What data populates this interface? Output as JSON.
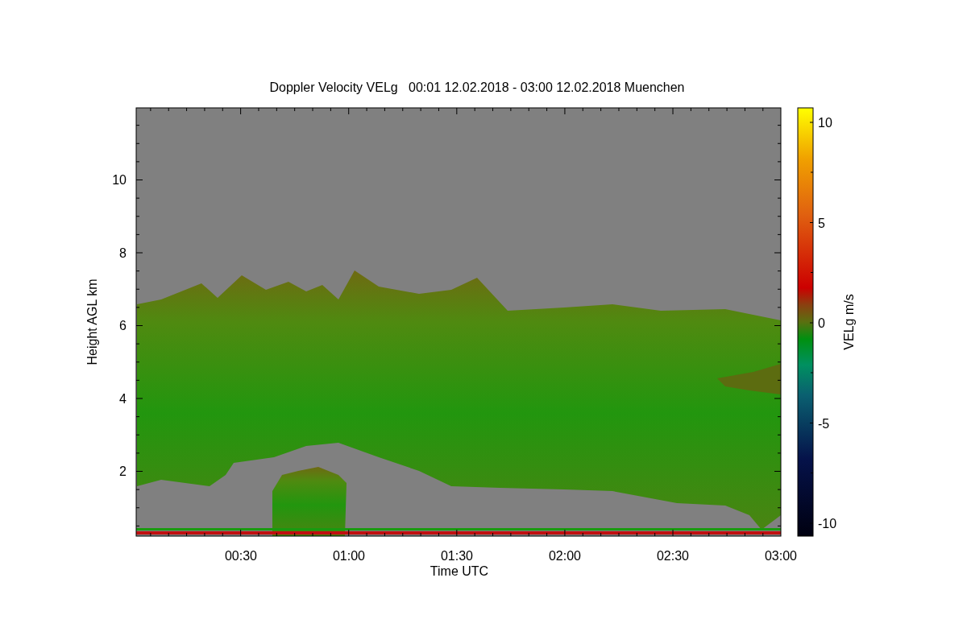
{
  "plot": {
    "title": "Doppler Velocity VELg   00:01 12.02.2018 - 03:00 12.02.2018 Muenchen",
    "xlabel": "Time UTC",
    "ylabel": "Height AGL km",
    "xticks": [
      "00:30",
      "01:00",
      "01:30",
      "02:00",
      "02:30",
      "03:00"
    ],
    "yticks": [
      "10",
      "8",
      "6",
      "4",
      "2"
    ]
  },
  "colorbar": {
    "label": "VELg m/s",
    "ticks": [
      "10",
      "5",
      "0",
      "-5",
      "-10"
    ]
  }
}
